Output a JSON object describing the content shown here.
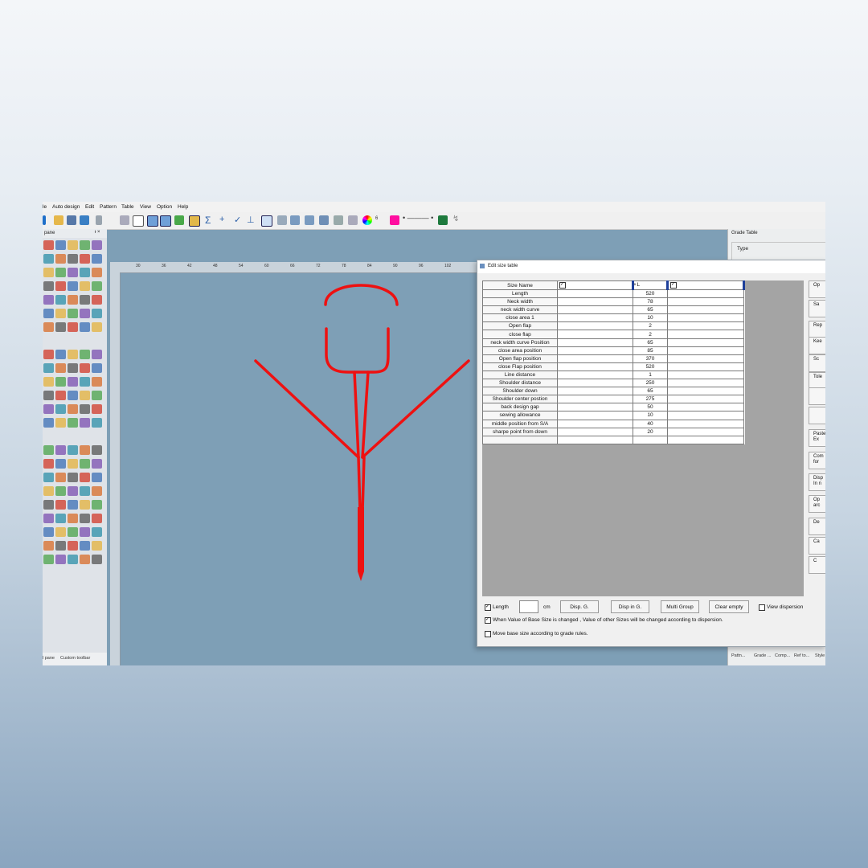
{
  "menu": [
    "le",
    "Auto design",
    "Edit",
    "Pattern",
    "Table",
    "View",
    "Option",
    "Help"
  ],
  "toolbar": {
    "color_value": "6"
  },
  "left_pane": {
    "title": "pane",
    "tabs": [
      "l pane",
      "Custom toolbar"
    ]
  },
  "ruler": {
    "h_ticks": [
      "30",
      "36",
      "42",
      "48",
      "54",
      "60",
      "66",
      "72",
      "78",
      "84",
      "90",
      "96",
      "102"
    ]
  },
  "grade_panel": {
    "title": "Grade Table",
    "type_label": "Type",
    "tabs": [
      "Pattn...",
      "Grade ...",
      "Comp...",
      "Ref to...",
      "Style"
    ]
  },
  "dialog": {
    "title": "Edit size table",
    "header": {
      "name": "Size Name",
      "col2": "L"
    },
    "rows": [
      {
        "name": "Length",
        "value": "520"
      },
      {
        "name": "Neck width",
        "value": "78"
      },
      {
        "name": "neck width curve",
        "value": "65"
      },
      {
        "name": "close area 1",
        "value": "10"
      },
      {
        "name": "Open flap",
        "value": "2"
      },
      {
        "name": "close flap",
        "value": "2"
      },
      {
        "name": "neck width curve Position",
        "value": "65"
      },
      {
        "name": "close area position",
        "value": "85"
      },
      {
        "name": "Open flap position",
        "value": "370"
      },
      {
        "name": "close Flap position",
        "value": "520"
      },
      {
        "name": "Line distance",
        "value": "1"
      },
      {
        "name": "Shoulder distance",
        "value": "250"
      },
      {
        "name": "Shoulder down",
        "value": "65"
      },
      {
        "name": "Shoulder center postion",
        "value": "275"
      },
      {
        "name": "back design gap",
        "value": "50"
      },
      {
        "name": "sewing allowance",
        "value": "10"
      },
      {
        "name": "middle position from S/A",
        "value": "40"
      },
      {
        "name": "sharpe point from down",
        "value": "20"
      }
    ],
    "side_buttons": [
      "Op",
      "Sa",
      "Rep",
      "Kee",
      "Sc",
      "Tole",
      "",
      "",
      "Paste Ex",
      "Com for",
      "Disp In n",
      "Op arc",
      "De",
      "Ca",
      "C"
    ],
    "bottom": {
      "length_label": "Length",
      "unit": "cm",
      "disp_g": "Disp. G.",
      "disp_in_g": "Disp in G.",
      "multi_group": "Multi Group",
      "clear_empty": "Clear empty",
      "view_dispersion": "View dispersion",
      "when_value": "When Value of Base Size is changed , Value of other Sizes will be changed  according to dispersion.",
      "move_base": "Move base size according to grade rules."
    }
  }
}
